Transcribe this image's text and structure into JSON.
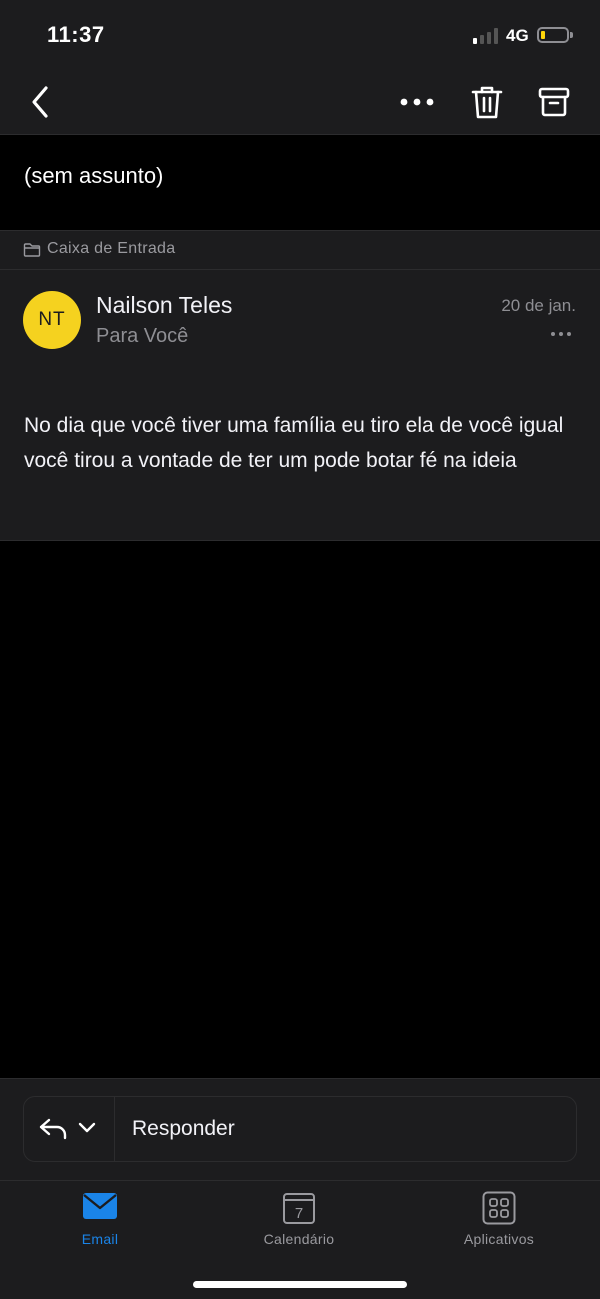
{
  "status_bar": {
    "time": "11:37",
    "network": "4G",
    "battery_color": "#ffd60a"
  },
  "email": {
    "subject": "(sem assunto)",
    "folder": "Caixa de Entrada",
    "sender_initials": "NT",
    "sender_name": "Nailson Teles",
    "recipient": "Para Você",
    "date": "20 de jan.",
    "body": "No dia que você tiver uma família eu tiro ela de você igual você tirou a vontade de ter um pode botar fé na ideia",
    "avatar_color": "#f5d21f"
  },
  "reply": {
    "label": "Responder"
  },
  "tabbar": {
    "tabs": [
      {
        "label": "Email",
        "icon": "mail-icon",
        "active": true
      },
      {
        "label": "Calendário",
        "icon": "calendar-icon",
        "active": false,
        "day": "7"
      },
      {
        "label": "Aplicativos",
        "icon": "apps-grid-icon",
        "active": false
      }
    ],
    "accent": "#1a84e8"
  },
  "icons": {
    "back": "chevron-left-icon",
    "more": "more-horizontal-icon",
    "delete": "trash-icon",
    "archive": "archive-icon",
    "folder": "folder-icon",
    "reply": "reply-icon",
    "reply_options": "chevron-down-icon"
  }
}
